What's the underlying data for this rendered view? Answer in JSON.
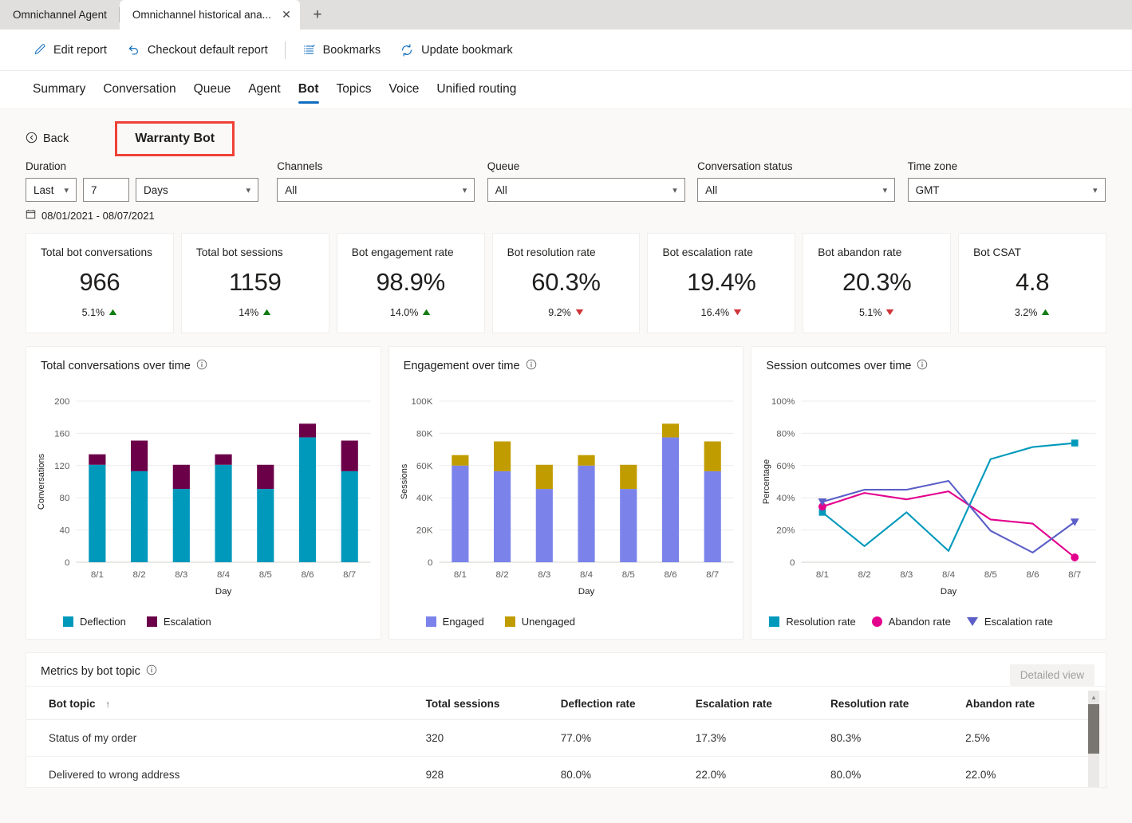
{
  "browser": {
    "tabs": [
      {
        "label": "Omnichannel Agent",
        "active": false
      },
      {
        "label": "Omnichannel historical ana...",
        "active": true
      }
    ],
    "close_icon": "close-icon",
    "new_tab_icon": "plus-icon"
  },
  "commandbar": {
    "items": [
      {
        "label": "Edit report",
        "icon": "pencil-icon"
      },
      {
        "label": "Checkout default report",
        "icon": "revert-icon"
      },
      {
        "label": "Bookmarks",
        "icon": "list-icon"
      },
      {
        "label": "Update bookmark",
        "icon": "refresh-icon"
      }
    ]
  },
  "navtabs": [
    {
      "label": "Summary",
      "selected": false
    },
    {
      "label": "Conversation",
      "selected": false
    },
    {
      "label": "Queue",
      "selected": false
    },
    {
      "label": "Agent",
      "selected": false
    },
    {
      "label": "Bot",
      "selected": true
    },
    {
      "label": "Topics",
      "selected": false
    },
    {
      "label": "Voice",
      "selected": false
    },
    {
      "label": "Unified routing",
      "selected": false
    }
  ],
  "page": {
    "back_label": "Back",
    "back_icon": "back-circle-icon",
    "bot_title": "Warranty Bot",
    "highlight_color": "#ef4136"
  },
  "filters": {
    "duration": {
      "label": "Duration",
      "relative_value": "Last",
      "amount_value": "7",
      "unit_value": "Days"
    },
    "channels": {
      "label": "Channels",
      "value": "All"
    },
    "queue": {
      "label": "Queue",
      "value": "All"
    },
    "conversation_status": {
      "label": "Conversation status",
      "value": "All"
    },
    "time_zone": {
      "label": "Time zone",
      "value": "GMT"
    },
    "date_range": "08/01/2021 - 08/07/2021",
    "calendar_icon": "calendar-icon"
  },
  "kpis": [
    {
      "title": "Total bot conversations",
      "value": "966",
      "delta": "5.1%",
      "dir": "up"
    },
    {
      "title": "Total bot sessions",
      "value": "1159",
      "delta": "14%",
      "dir": "up"
    },
    {
      "title": "Bot engagement rate",
      "value": "98.9%",
      "delta": "14.0%",
      "dir": "up"
    },
    {
      "title": "Bot resolution rate",
      "value": "60.3%",
      "delta": "9.2%",
      "dir": "down"
    },
    {
      "title": "Bot escalation rate",
      "value": "19.4%",
      "delta": "16.4%",
      "dir": "down"
    },
    {
      "title": "Bot abandon rate",
      "value": "20.3%",
      "delta": "5.1%",
      "dir": "down"
    },
    {
      "title": "Bot CSAT",
      "value": "4.8",
      "delta": "3.2%",
      "dir": "up"
    }
  ],
  "kpi_colors": {
    "up": "#107c10",
    "down": "#d13438"
  },
  "chart_data": [
    {
      "type": "bar",
      "title": "Total conversations over time",
      "stacked": true,
      "categories": [
        "8/1",
        "8/2",
        "8/3",
        "8/4",
        "8/5",
        "8/6",
        "8/7"
      ],
      "series": [
        {
          "name": "Deflection",
          "color": "#0099bc",
          "values": [
            121,
            113,
            91,
            121,
            91,
            155,
            113
          ]
        },
        {
          "name": "Escalation",
          "color": "#6b0049",
          "values": [
            13,
            38,
            30,
            13,
            30,
            17,
            38
          ]
        }
      ],
      "xlabel": "Day",
      "ylabel": "Conversations",
      "ylim": [
        0,
        200
      ],
      "yticks": [
        "0",
        "40",
        "80",
        "120",
        "160",
        "200"
      ],
      "grid": true,
      "legend_position": "bottom",
      "info_icon": "info-icon"
    },
    {
      "type": "bar",
      "title": "Engagement over time",
      "stacked": true,
      "categories": [
        "8/1",
        "8/2",
        "8/3",
        "8/4",
        "8/5",
        "8/6",
        "8/7"
      ],
      "series": [
        {
          "name": "Engaged",
          "color": "#7b83eb",
          "values": [
            60000,
            56500,
            45500,
            60000,
            45500,
            77500,
            56500
          ]
        },
        {
          "name": "Unengaged",
          "color": "#c19c00",
          "values": [
            6500,
            18500,
            15000,
            6500,
            15000,
            8500,
            18500
          ]
        }
      ],
      "xlabel": "Day",
      "ylabel": "Sessions",
      "ylim": [
        0,
        100000
      ],
      "yticks": [
        "0",
        "20K",
        "40K",
        "60K",
        "80K",
        "100K"
      ],
      "grid": true,
      "legend_position": "bottom",
      "info_icon": "info-icon"
    },
    {
      "type": "line",
      "title": "Session outcomes over time",
      "categories": [
        "8/1",
        "8/2",
        "8/3",
        "8/4",
        "8/5",
        "8/6",
        "8/7"
      ],
      "series": [
        {
          "name": "Resolution rate",
          "color": "#0099bc",
          "marker": "square",
          "values": [
            31,
            10,
            31,
            7,
            64,
            71.5,
            74
          ]
        },
        {
          "name": "Abandon rate",
          "color": "#e3008c",
          "marker": "circle",
          "values": [
            34.5,
            43,
            39,
            44,
            26.5,
            24,
            3
          ]
        },
        {
          "name": "Escalation rate",
          "color": "#5b5fc7",
          "marker": "triangle-down",
          "values": [
            37.5,
            45,
            45,
            50.5,
            19.5,
            6,
            25
          ]
        }
      ],
      "xlabel": "Day",
      "ylabel": "Percentage",
      "ylim": [
        0,
        100
      ],
      "yticks": [
        "0",
        "20%",
        "40%",
        "60%",
        "80%",
        "100%"
      ],
      "grid": true,
      "legend_position": "bottom",
      "info_icon": "info-icon"
    }
  ],
  "topic_table": {
    "title": "Metrics by bot topic",
    "info_icon": "info-icon",
    "detailed_view_label": "Detailed view",
    "sort_column": "Bot topic",
    "sort_icon": "arrow-up-icon",
    "columns": [
      "Bot topic",
      "Total sessions",
      "Deflection rate",
      "Escalation rate",
      "Resolution rate",
      "Abandon rate"
    ],
    "rows": [
      [
        "Status of my order",
        "320",
        "77.0%",
        "17.3%",
        "80.3%",
        "2.5%"
      ],
      [
        "Delivered to wrong address",
        "928",
        "80.0%",
        "22.0%",
        "80.0%",
        "22.0%"
      ]
    ]
  }
}
